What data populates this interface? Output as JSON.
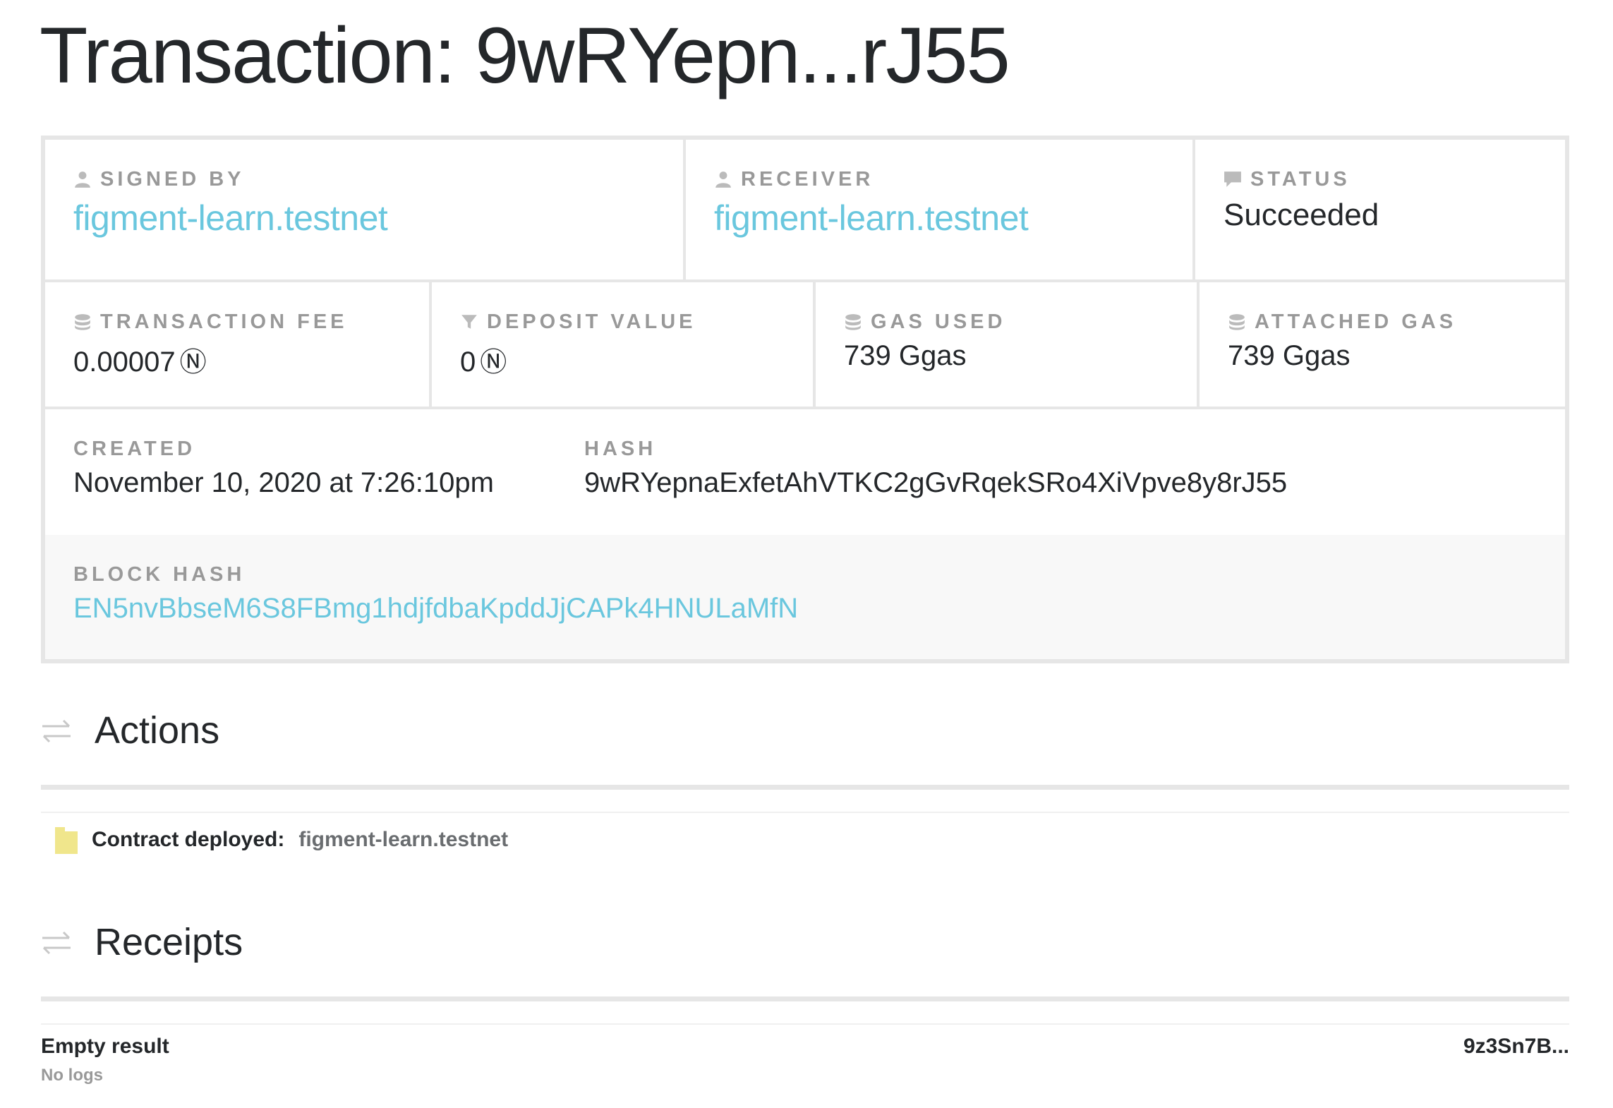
{
  "page": {
    "title": "Transaction: 9wRYepn...rJ55"
  },
  "overview": {
    "signed_by": {
      "label": "SIGNED BY",
      "value": "figment-learn.testnet",
      "icon": "user-icon"
    },
    "receiver": {
      "label": "RECEIVER",
      "value": "figment-learn.testnet",
      "icon": "user-icon"
    },
    "status": {
      "label": "STATUS",
      "value": "Succeeded",
      "icon": "speech-bubble-icon"
    },
    "transaction_fee": {
      "label": "TRANSACTION FEE",
      "value": "0.00007",
      "unit": "Ⓝ",
      "icon": "coins-icon"
    },
    "deposit_value": {
      "label": "DEPOSIT VALUE",
      "value": "0",
      "unit": "Ⓝ",
      "icon": "filter-icon"
    },
    "gas_used": {
      "label": "GAS USED",
      "value": "739 Ggas",
      "icon": "coins-icon"
    },
    "attached_gas": {
      "label": "ATTACHED GAS",
      "value": "739 Ggas",
      "icon": "coins-icon"
    },
    "created": {
      "label": "CREATED",
      "value": "November 10, 2020 at 7:26:10pm"
    },
    "hash": {
      "label": "HASH",
      "value": "9wRYepnaExfetAhVTKC2gGvRqekSRo4XiVpve8y8rJ55"
    },
    "block_hash": {
      "label": "BLOCK HASH",
      "value": "EN5nvBbseM6S8FBmg1hdjfdbaKpddJjCAPk4HNULaMfN"
    }
  },
  "actions": {
    "heading": "Actions",
    "items": [
      {
        "label": "Contract deployed:",
        "value": "figment-learn.testnet",
        "icon": "file-icon"
      }
    ]
  },
  "receipts": {
    "heading": "Receipts",
    "items": [
      {
        "status": "Empty result",
        "logs": "No logs",
        "id": "9z3Sn7B..."
      }
    ]
  },
  "colors": {
    "accent": "#6ac7de",
    "text": "#24272a",
    "muted": "#999999",
    "border": "#e6e6e6",
    "action_icon": "#f0e68c"
  }
}
